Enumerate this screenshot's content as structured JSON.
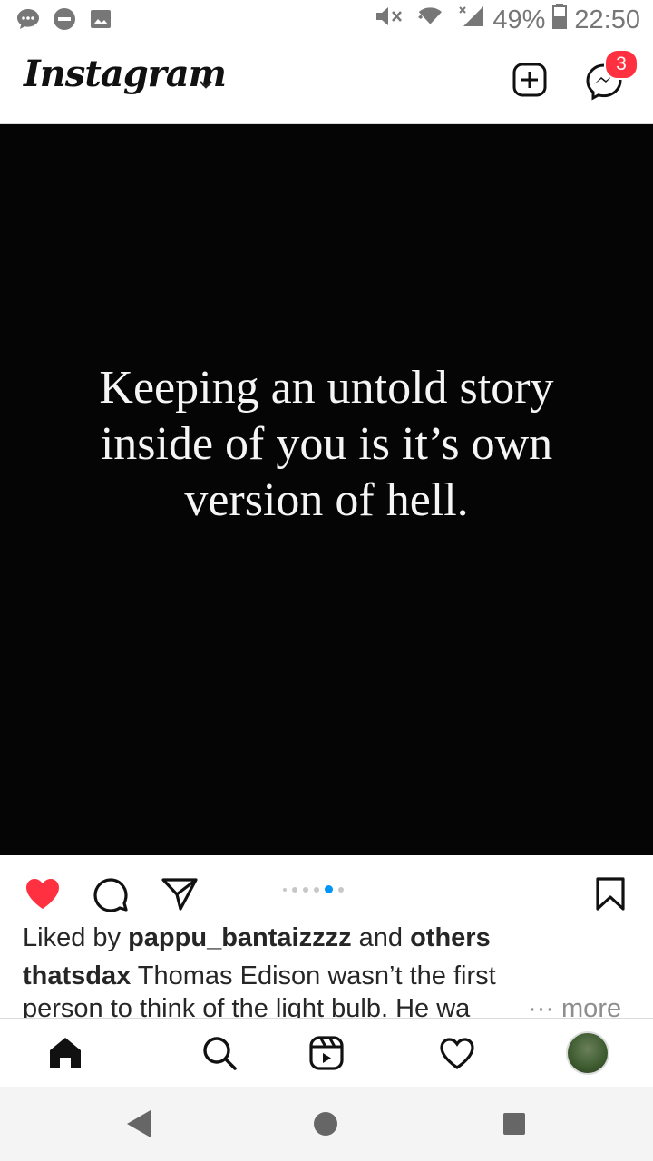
{
  "status_bar": {
    "battery": "49%",
    "time": "22:50"
  },
  "header": {
    "logo": "Instagram",
    "messages_badge": "3"
  },
  "post": {
    "quote_lines": [
      "Keeping an untold story",
      "inside of you is it’s own",
      "version of hell."
    ],
    "carousel": {
      "count": 6,
      "active_index": 4
    },
    "likes": {
      "prefix": "Liked by ",
      "user": "pappu_bantaizzzz",
      "middle": " and ",
      "suffix": "others"
    },
    "caption": {
      "author": "thatsdax",
      "text_line1": " Thomas Edison wasn’t the first",
      "text_line2": "person to think of the light bulb. He wa",
      "more": "··· more"
    }
  },
  "colors": {
    "like": "#ff3040",
    "accent": "#0095f6"
  },
  "icons": {
    "actions": [
      "heart-filled-icon",
      "comment-icon",
      "share-icon",
      "bookmark-icon"
    ],
    "nav": [
      "home-icon",
      "search-icon",
      "reels-icon",
      "activity-heart-icon",
      "profile-avatar"
    ]
  }
}
